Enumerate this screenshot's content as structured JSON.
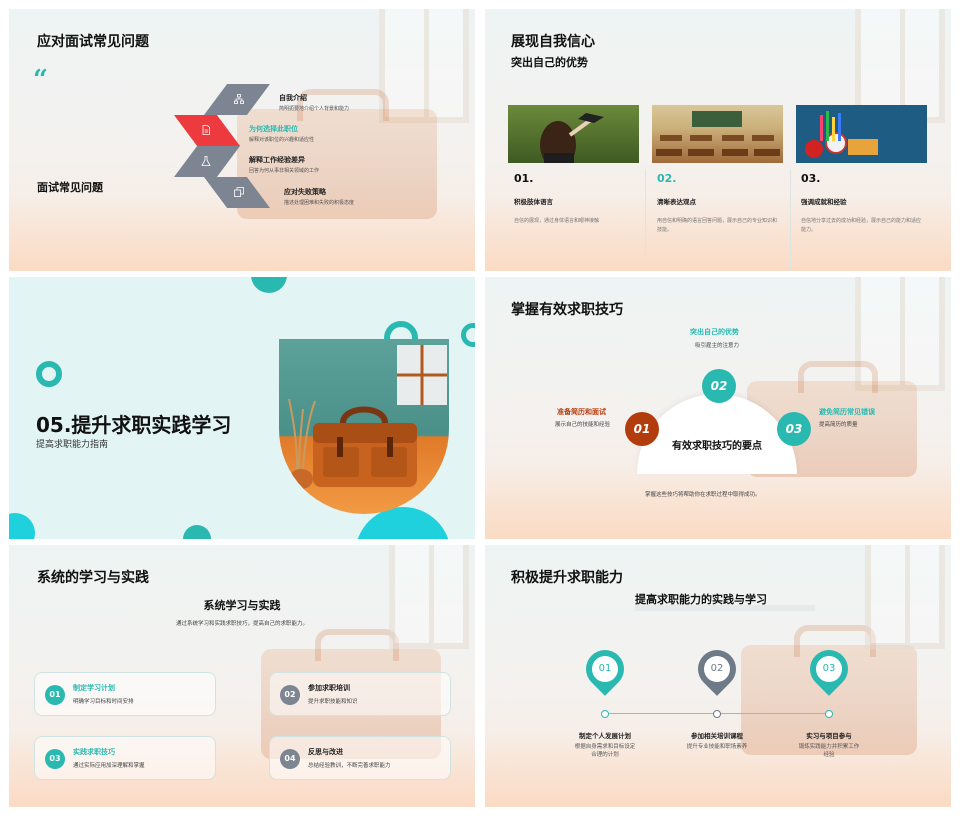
{
  "slides": {
    "s1": {
      "title": "应对面试常见问题",
      "quote_mark": "“",
      "side_label": "面试常见问题",
      "items": [
        {
          "title": "自我介绍",
          "desc": "简明扼要地介绍个人背景和能力",
          "icon": "org-chart-icon"
        },
        {
          "title": "为何选择此职位",
          "desc": "解释对该职位的兴趣和适应性",
          "icon": "document-icon"
        },
        {
          "title": "解释工作经验差异",
          "desc": "回答为何从事非相关领域的工作",
          "icon": "flask-icon"
        },
        {
          "title": "应对失败策略",
          "desc": "描述处理困难和失败的积极态度",
          "icon": "copy-icon"
        }
      ]
    },
    "s2": {
      "title": "展现自我信心",
      "subtitle": "突出自己的优势",
      "cards": [
        {
          "num": "01.",
          "head": "积极肢体语言",
          "desc": "自信的展现，通过身体语言和眼神接触"
        },
        {
          "num": "02.",
          "head": "清晰表达观点",
          "desc": "用自信和明确的语言回答问题，展示自己的专业知识和技能。"
        },
        {
          "num": "03.",
          "head": "强调成就和经验",
          "desc": "自信地分享过去的成功和经验，展示自己的能力和适应能力。"
        }
      ]
    },
    "s3": {
      "title": "05.提升求职实践学习",
      "subtitle": "提高求职能力指南"
    },
    "s4": {
      "title": "掌握有效求职技巧",
      "center": "有效求职技巧的要点",
      "footer": "掌握这些技巧将帮助你在求职过程中取得成功。",
      "items": [
        {
          "num": "01",
          "title": "准备简历和面试",
          "desc": "展示自己的技能和经验"
        },
        {
          "num": "02",
          "title": "突出自己的优势",
          "desc": "吸引雇主的注意力"
        },
        {
          "num": "03",
          "title": "避免简历常见错误",
          "desc": "提高简历的质量"
        }
      ]
    },
    "s5": {
      "title": "系统的学习与实践",
      "subtitle": "系统学习与实践",
      "desc": "通过系统学习和实践求职技巧，提高自己的求职能力。",
      "cards": [
        {
          "num": "01",
          "title": "制定学习计划",
          "desc": "明确学习目标和时间安排"
        },
        {
          "num": "02",
          "title": "参加求职培训",
          "desc": "提升求职技能和知识"
        },
        {
          "num": "03",
          "title": "实践求职技巧",
          "desc": "通过实际应用加深理解和掌握"
        },
        {
          "num": "04",
          "title": "反思与改进",
          "desc": "总结经验教训，不断完善求职能力"
        }
      ]
    },
    "s6": {
      "title": "积极提升求职能力",
      "subtitle": "提高求职能力的实践与学习",
      "steps": [
        {
          "num": "01",
          "title": "制定个人发展计划",
          "desc": "根据自身需求和目标设定合理的计划"
        },
        {
          "num": "02",
          "title": "参加相关培训课程",
          "desc": "提升专业技能和职场素养"
        },
        {
          "num": "03",
          "title": "实习与项目参与",
          "desc": "锻炼实践能力并积累工作经验"
        }
      ]
    }
  },
  "colors": {
    "teal": "#2ab9b0",
    "red": "#ec3a3f",
    "gray": "#7d8592",
    "rust": "#b23c0c"
  }
}
